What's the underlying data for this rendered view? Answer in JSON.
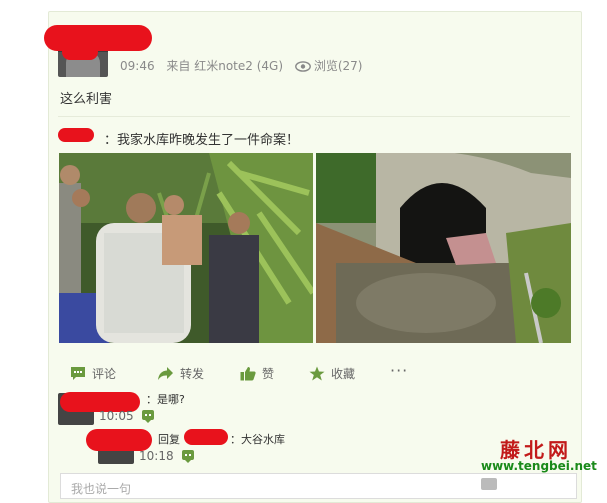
{
  "post": {
    "time": "09:46",
    "source": "来自 红米note2 (4G)",
    "views_label": "浏览(27)",
    "text": "这么利害",
    "repost_text": "：我家水库昨晚发生了一件命案！"
  },
  "actions": {
    "comment": "评论",
    "repost": "转发",
    "like": "赞",
    "favorite": "收藏",
    "more": "···"
  },
  "comments": [
    {
      "text": "：是哪?",
      "time": "10:05"
    },
    {
      "reply_label": "回复",
      "text": "：大谷水库",
      "time": "10:18"
    }
  ],
  "input": {
    "placeholder": "我也说一句"
  },
  "watermark": {
    "title": "藤北网",
    "url": "www.tengbei.net"
  },
  "colors": {
    "accent_green": "#6a9a3e",
    "redaction": "#e8121c",
    "card_bg": "#f7fbee"
  }
}
